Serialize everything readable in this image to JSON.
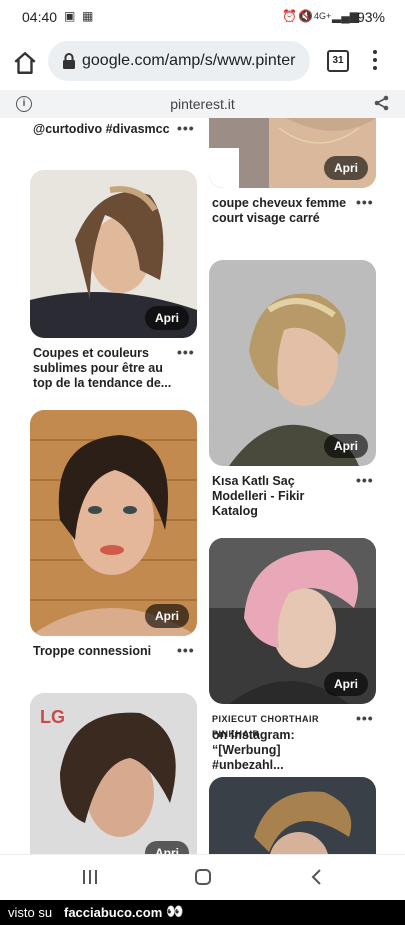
{
  "status": {
    "time": "04:40",
    "battery": "93%",
    "network": "4G+"
  },
  "browser": {
    "url": "google.com/amp/s/www.pinter",
    "tab_count": "31"
  },
  "amp_bar": {
    "domain": "pinterest.it"
  },
  "pins": {
    "top_left_caption": "@curtodivo #divasmcc",
    "top_right_caption": "coupe cheveux femme court visage carré",
    "p1_caption": "Coupes et couleurs sublimes pour être au top de la tendance de...",
    "p2_caption": "Kısa Katlı Saç Modelleri - Fikir Katalog",
    "p3_caption": "Troppe connessioni",
    "p4_caption_brand": "PIXIECUT CHORTHAIR PINKHAIR",
    "p4_caption": "on Instagram: “[Werbung] #unbezahl...",
    "open_label": "Apri"
  },
  "footer": {
    "visto": "visto su",
    "site": "facciabuco.com",
    "eyes": "👀"
  }
}
